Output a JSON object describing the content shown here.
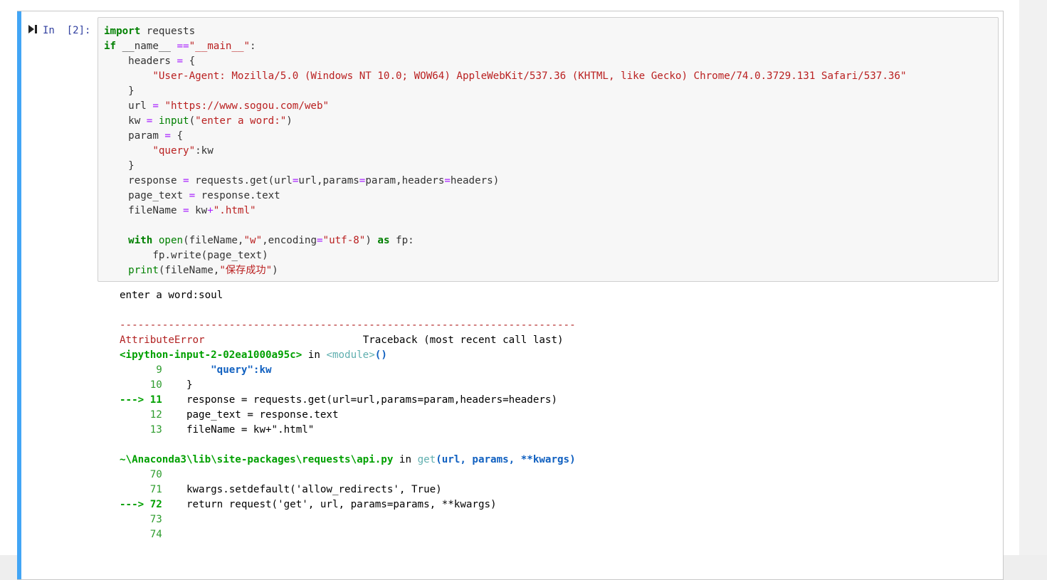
{
  "cell": {
    "prompt": "In  [2]:",
    "code_lines": [
      "import requests",
      "if __name__ ==\"__main__\":",
      "    headers = {",
      "        \"User-Agent: Mozilla/5.0 (Windows NT 10.0; WOW64) AppleWebKit/537.36 (KHTML, like Gecko) Chrome/74.0.3729.131 Safari/537.36\"",
      "    }",
      "    url = \"https://www.sogou.com/web\"",
      "    kw = input(\"enter a word:\")",
      "    param = {",
      "        \"query\":kw",
      "    }",
      "    response = requests.get(url=url,params=param,headers=headers)",
      "    page_text = response.text",
      "    fileName = kw+\".html\"",
      "",
      "    with open(fileName,\"w\",encoding=\"utf-8\") as fp:",
      "        fp.write(page_text)",
      "    print(fileName,\"保存成功\")"
    ]
  },
  "output": {
    "stdin_line": "enter a word:soul",
    "separator": "---------------------------------------------------------------------------",
    "error_name": "AttributeError",
    "traceback_label": "Traceback (most recent call last)",
    "frame1_file": "<ipython-input-2-02ea1000a95c>",
    "frame1_in": "in",
    "frame1_func": "<module>",
    "frame1_args": "()",
    "frame1_lines": [
      {
        "arrow": "",
        "no": "9",
        "code": "        \"query\":kw"
      },
      {
        "arrow": "",
        "no": "10",
        "code": "    }"
      },
      {
        "arrow": "--->",
        "no": "11",
        "code": "    response = requests.get(url=url,params=param,headers=headers)"
      },
      {
        "arrow": "",
        "no": "12",
        "code": "    page_text = response.text"
      },
      {
        "arrow": "",
        "no": "13",
        "code": "    fileName = kw+\".html\""
      }
    ],
    "frame2_file": "~\\Anaconda3\\lib\\site-packages\\requests\\api.py",
    "frame2_in": "in",
    "frame2_func": "get",
    "frame2_args": "(url, params, **kwargs)",
    "frame2_lines": [
      {
        "arrow": "",
        "no": "70",
        "code": ""
      },
      {
        "arrow": "",
        "no": "71",
        "code": "    kwargs.setdefault('allow_redirects', True)"
      },
      {
        "arrow": "--->",
        "no": "72",
        "code": "    return request('get', url, params=params, **kwargs)"
      },
      {
        "arrow": "",
        "no": "73",
        "code": ""
      },
      {
        "arrow": "",
        "no": "74",
        "code": ""
      }
    ]
  },
  "colors": {
    "cell_selected_bar": "#42a5f5",
    "keyword": "#008000",
    "string": "#ba2121",
    "error": "#b22222"
  },
  "icons": {
    "run": "run-cell-icon"
  }
}
